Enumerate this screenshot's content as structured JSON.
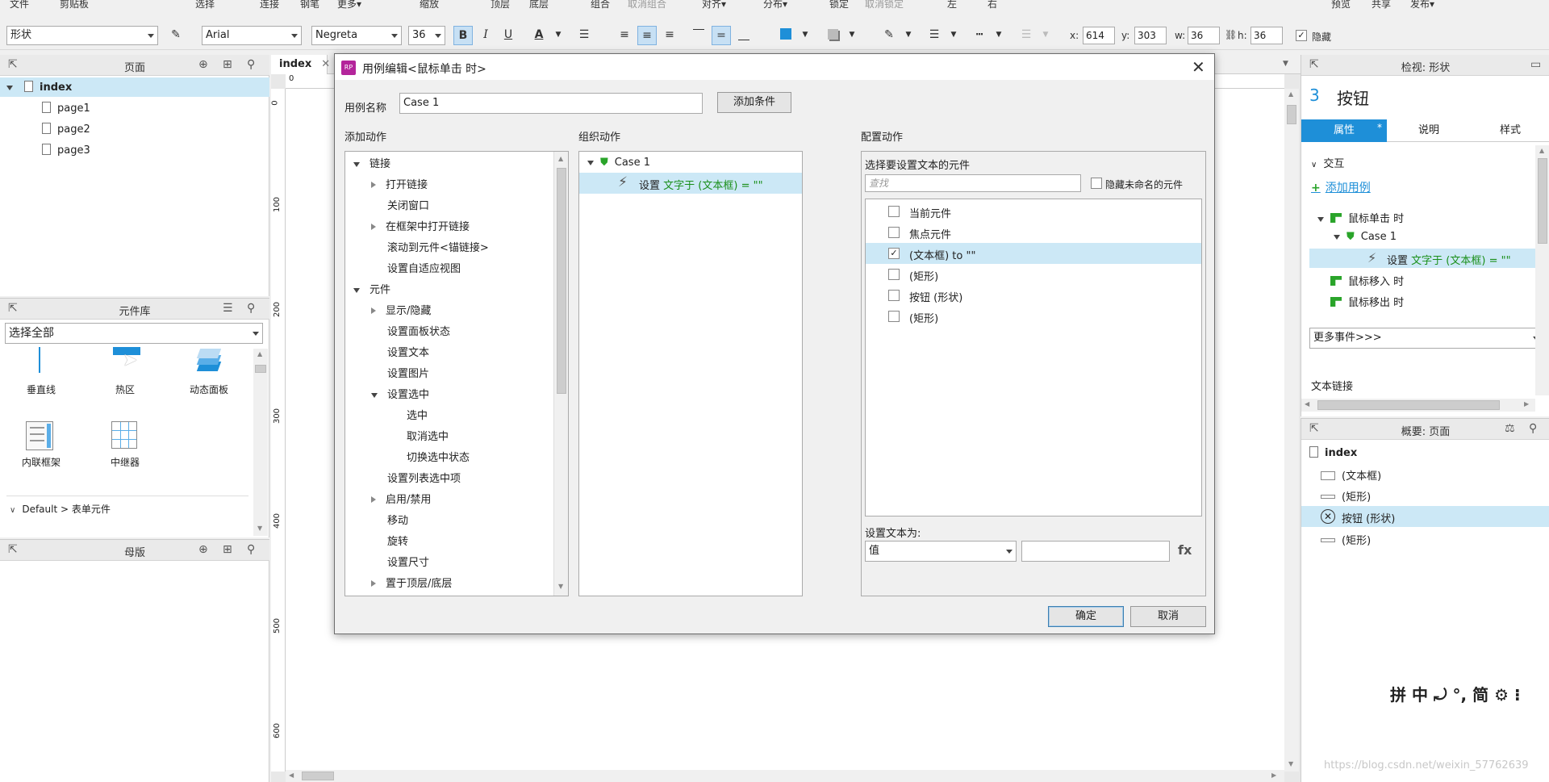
{
  "menubar": {
    "items": [
      "文件",
      "剪贴板",
      "选择",
      "连接",
      "钢笔",
      "更多▾",
      "缩放",
      "顶层",
      "底层",
      "组合",
      "取消组合",
      "对齐▾",
      "分布▾",
      "锁定",
      "取消锁定",
      "左",
      "右",
      "预览",
      "共享",
      "发布▾"
    ]
  },
  "toolbar": {
    "shape_type": "形状",
    "font_family": "Arial",
    "font_style": "Negreta",
    "font_size": "36",
    "x_label": "x:",
    "x_value": "614",
    "y_label": "y:",
    "y_value": "303",
    "w_label": "w:",
    "w_value": "36",
    "h_label": "h:",
    "h_value": "36",
    "hidden_label": "隐藏"
  },
  "pages_panel": {
    "title": "页面",
    "root": "index",
    "pages": [
      "page1",
      "page2",
      "page3"
    ]
  },
  "library_panel": {
    "title": "元件库",
    "filter": "选择全部",
    "widgets": [
      "垂直线",
      "热区",
      "动态面板",
      "内联框架",
      "中继器"
    ],
    "section": "Default > 表单元件"
  },
  "masters_panel": {
    "title": "母版"
  },
  "canvas": {
    "tab": "index",
    "ruler_top_zero": "0",
    "ruler_marks": [
      "0",
      "100",
      "200",
      "300",
      "400",
      "500",
      "600"
    ]
  },
  "dialog": {
    "title": "用例编辑<鼠标单击 时>",
    "case_name_label": "用例名称",
    "case_name_value": "Case 1",
    "add_condition": "添加条件",
    "col1_title": "添加动作",
    "col2_title": "组织动作",
    "col3_title": "配置动作",
    "actions": [
      {
        "label": "链接",
        "kind": "group"
      },
      {
        "label": "打开链接",
        "kind": "collapsed"
      },
      {
        "label": "关闭窗口",
        "kind": "leaf"
      },
      {
        "label": "在框架中打开链接",
        "kind": "collapsed"
      },
      {
        "label": "滚动到元件<锚链接>",
        "kind": "leaf"
      },
      {
        "label": "设置自适应视图",
        "kind": "leaf"
      },
      {
        "label": "元件",
        "kind": "group"
      },
      {
        "label": "显示/隐藏",
        "kind": "collapsed"
      },
      {
        "label": "设置面板状态",
        "kind": "leaf"
      },
      {
        "label": "设置文本",
        "kind": "leaf"
      },
      {
        "label": "设置图片",
        "kind": "leaf"
      },
      {
        "label": "设置选中",
        "kind": "expanded"
      },
      {
        "label": "选中",
        "kind": "sub"
      },
      {
        "label": "取消选中",
        "kind": "sub"
      },
      {
        "label": "切换选中状态",
        "kind": "sub"
      },
      {
        "label": "设置列表选中项",
        "kind": "leaf"
      },
      {
        "label": "启用/禁用",
        "kind": "collapsed"
      },
      {
        "label": "移动",
        "kind": "leaf"
      },
      {
        "label": "旋转",
        "kind": "leaf"
      },
      {
        "label": "设置尺寸",
        "kind": "leaf"
      },
      {
        "label": "置于顶层/底层",
        "kind": "collapsed"
      }
    ],
    "organize": {
      "case": "Case 1",
      "action_prefix": "设置",
      "action_detail": "文字于 (文本框) = \"\""
    },
    "config": {
      "heading": "选择要设置文本的元件",
      "search_placeholder": "查找",
      "hide_unnamed": "隐藏未命名的元件",
      "widgets": [
        {
          "label": "当前元件",
          "checked": false
        },
        {
          "label": "焦点元件",
          "checked": false
        },
        {
          "label": "(文本框) to \"\"",
          "checked": true
        },
        {
          "label": "(矩形)",
          "checked": false
        },
        {
          "label": "按钮 (形状)",
          "checked": false
        },
        {
          "label": "(矩形)",
          "checked": false
        }
      ],
      "set_text_label": "设置文本为:",
      "value_type": "值",
      "fx": "fx"
    },
    "ok": "确定",
    "cancel": "取消"
  },
  "inspector": {
    "title": "检视: 形状",
    "badge": "3",
    "name": "按钮",
    "tabs": [
      "属性",
      "说明",
      "样式"
    ],
    "interaction": "交互",
    "add_case": "添加用例",
    "events": [
      {
        "label": "鼠标单击 时",
        "level": 0
      },
      {
        "label": "Case 1",
        "level": 1
      },
      {
        "label": "鼠标移入 时",
        "level": 0
      },
      {
        "label": "鼠标移出 时",
        "level": 0
      }
    ],
    "case_action_prefix": "设置",
    "case_action_detail": "文字于 (文本框) = \"\"",
    "more_events": "更多事件>>>",
    "text_link": "文本链接"
  },
  "outline": {
    "title": "概要: 页面",
    "root": "index",
    "items": [
      "(文本框)",
      "(矩形)",
      "按钮 (形状)",
      "(矩形)"
    ]
  },
  "ime_bar": "拼 中 ⤾ °, 简 ⚙ ⁝",
  "watermark": "https://blog.csdn.net/weixin_57762639"
}
